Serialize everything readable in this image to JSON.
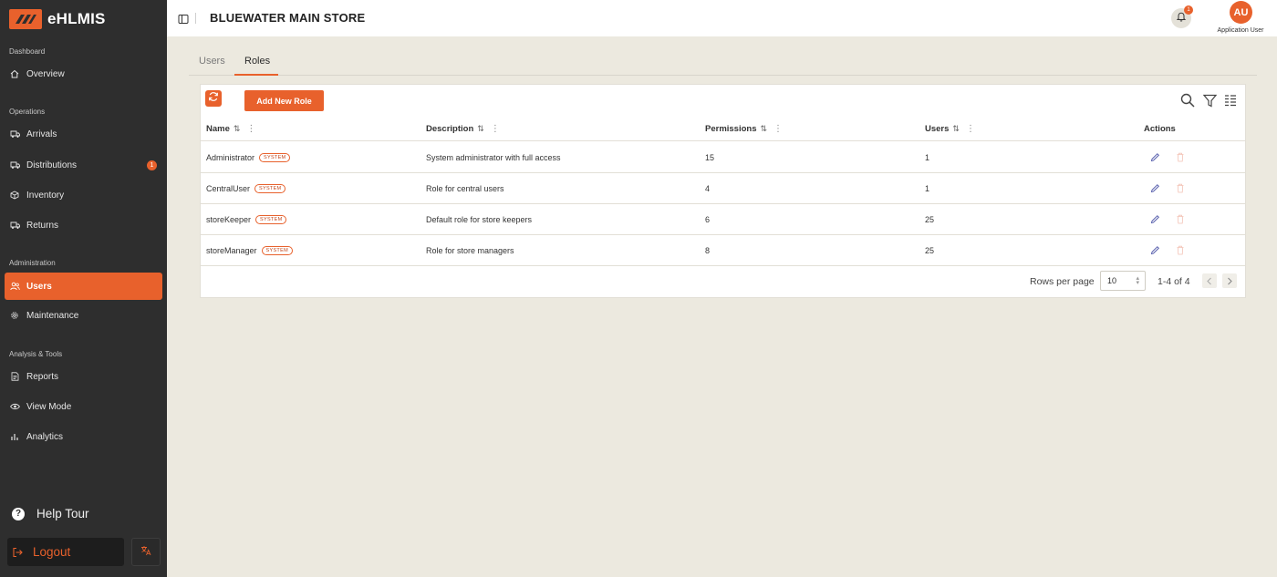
{
  "app": {
    "name": "eHLMIS"
  },
  "header": {
    "store_title": "BLUEWATER MAIN STORE",
    "notification_count": "1",
    "avatar_initials": "AU",
    "user_name": "Application User"
  },
  "sidebar": {
    "sections": {
      "dashboard": "Dashboard",
      "operations": "Operations",
      "administration": "Administration",
      "analysis": "Analysis & Tools"
    },
    "items": {
      "overview": "Overview",
      "arrivals": "Arrivals",
      "distributions": "Distributions",
      "distributions_badge": "1",
      "inventory": "Inventory",
      "returns": "Returns",
      "users": "Users",
      "maintenance": "Maintenance",
      "reports": "Reports",
      "view_mode": "View Mode",
      "analytics": "Analytics"
    },
    "help_tour": "Help Tour",
    "logout": "Logout"
  },
  "tabs": [
    "Users",
    "Roles"
  ],
  "toolbar": {
    "add_button": "Add New Role"
  },
  "table": {
    "headers": {
      "name": "Name",
      "description": "Description",
      "permissions": "Permissions",
      "users": "Users",
      "actions": "Actions"
    },
    "rows": [
      {
        "name": "Administrator",
        "badge": "SYSTEM",
        "description": "System administrator with full access",
        "permissions": "15",
        "users": "1"
      },
      {
        "name": "CentralUser",
        "badge": "SYSTEM",
        "description": "Role for central users",
        "permissions": "4",
        "users": "1"
      },
      {
        "name": "storeKeeper",
        "badge": "SYSTEM",
        "description": "Default role for store keepers",
        "permissions": "6",
        "users": "25"
      },
      {
        "name": "storeManager",
        "badge": "SYSTEM",
        "description": "Role for store managers",
        "permissions": "8",
        "users": "25"
      }
    ]
  },
  "pagination": {
    "rows_per_page_label": "Rows per page",
    "rows_per_page": "10",
    "range": "1-4 of 4"
  },
  "colors": {
    "accent": "#e8612c",
    "sidebar_bg": "#2e2e2e",
    "page_bg": "#ece9df"
  }
}
